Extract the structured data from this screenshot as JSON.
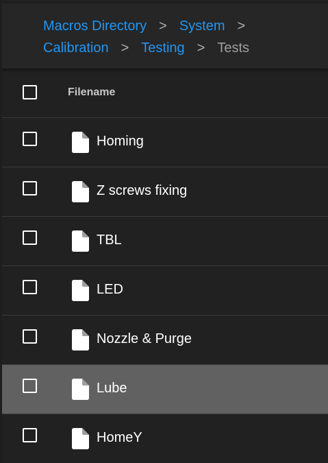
{
  "breadcrumb": {
    "items": [
      {
        "label": "Macros Directory",
        "link": true
      },
      {
        "label": "System",
        "link": true
      },
      {
        "label": "Calibration",
        "link": true
      },
      {
        "label": "Testing",
        "link": true
      },
      {
        "label": "Tests",
        "link": false
      }
    ],
    "separator": ">"
  },
  "table": {
    "header": {
      "filename": "Filename"
    },
    "rows": [
      {
        "name": "Homing",
        "icon": "file-icon",
        "selected": false
      },
      {
        "name": "Z screws fixing",
        "icon": "file-icon",
        "selected": false
      },
      {
        "name": "TBL",
        "icon": "file-icon",
        "selected": false
      },
      {
        "name": "LED",
        "icon": "file-icon",
        "selected": false
      },
      {
        "name": "Nozzle & Purge",
        "icon": "file-icon",
        "selected": false
      },
      {
        "name": "Lube",
        "icon": "file-icon",
        "selected": true
      },
      {
        "name": "HomeY",
        "icon": "file-icon",
        "selected": false
      }
    ]
  },
  "colors": {
    "background": "#212121",
    "link": "#2196f3",
    "current": "#9e9e9e",
    "row_selected": "#616161",
    "divider": "#3a3a3a"
  }
}
